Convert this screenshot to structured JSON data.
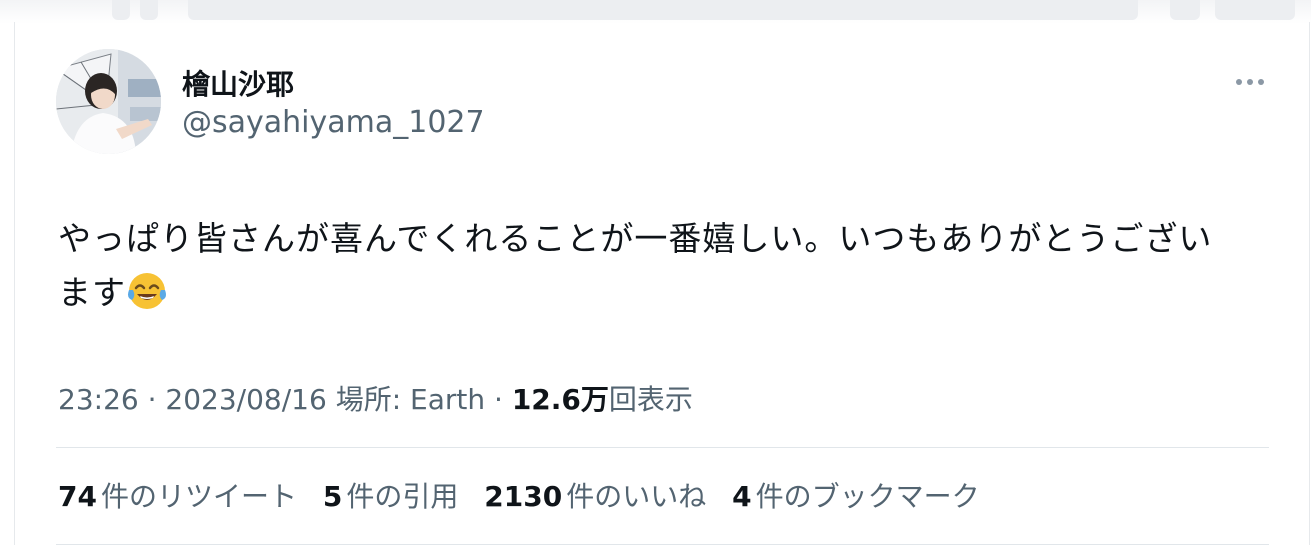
{
  "tweet": {
    "author": {
      "display_name": "檜山沙耶",
      "handle": "@sayahiyama_1027"
    },
    "text_lines": [
      "やっぱり皆さんが喜んでくれることが一番嬉しい。いつもありがとうござい",
      "ます"
    ],
    "emoji_icon": "face-with-tears-of-joy-emoji",
    "meta": {
      "time": "23:26",
      "sep1": " · ",
      "date": "2023/08/16",
      "location": " 場所: Earth",
      "sep2": " · ",
      "views_count": "12.6万",
      "views_label": "回表示"
    },
    "stats": [
      {
        "count": "74",
        "label": "件のリツイート"
      },
      {
        "count": "5",
        "label": "件の引用"
      },
      {
        "count": "2130",
        "label": "件のいいね"
      },
      {
        "count": "4",
        "label": "件のブックマーク"
      }
    ],
    "more_icon": "more-horizontal-icon",
    "colors": {
      "text": "#0f1419",
      "secondary": "#536471",
      "divider": "#e1e6ea"
    }
  }
}
